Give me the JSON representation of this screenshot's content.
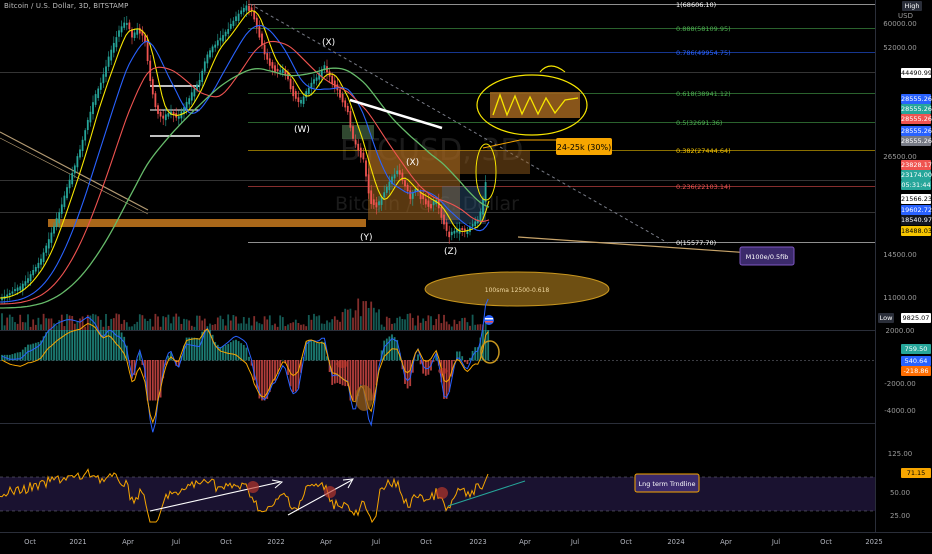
{
  "header": {
    "symbol_title": "Bitcoin / U.S. Dollar, 3D, BITSTAMP",
    "high_badge": "High",
    "usd_label": "USD",
    "low_badge": "Low"
  },
  "watermark": {
    "line1": "BTCUSD, 3D",
    "line2": "Bitcoin / U.S. Dollar"
  },
  "price_axis": {
    "ticks": [
      "60000.00",
      "52000.00",
      "44490.99",
      "26500.00",
      "21566.23",
      "18488.03",
      "14500.00",
      "11000.00",
      "9825.07"
    ],
    "tags": [
      {
        "text": "28555.26",
        "color": "#2962ff"
      },
      {
        "text": "28555.26",
        "color": "#26a69a"
      },
      {
        "text": "28555.26",
        "color": "#ef5350"
      },
      {
        "text": "28555.26",
        "color": "#2962ff"
      },
      {
        "text": "28555.26",
        "color": "#787b86"
      },
      {
        "text": "23828.17",
        "color": "#ef5350"
      },
      {
        "text": "23174.00",
        "color": "#26a69a"
      },
      {
        "text": "05:31:44",
        "color": "#26a69a"
      },
      {
        "text": "19602.72",
        "color": "#2962ff"
      },
      {
        "text": "18540.97",
        "color": "#000000"
      },
      {
        "text": "18488.03",
        "color": "#f7c600"
      }
    ]
  },
  "macd_axis": {
    "ticks": [
      "2000.00",
      "-2000.00",
      "-4000.00"
    ],
    "tags": [
      {
        "text": "759.50",
        "color": "#26a69a"
      },
      {
        "text": "540.64",
        "color": "#2962ff"
      },
      {
        "text": "-218.86",
        "color": "#ff6d00"
      }
    ]
  },
  "rsi_axis": {
    "ticks": [
      "125.00",
      "50.00",
      "25.00"
    ],
    "tag": {
      "text": "71.15",
      "color": "#f7a600"
    }
  },
  "time_axis": [
    "Oct",
    "2021",
    "Apr",
    "Jul",
    "Oct",
    "2022",
    "Apr",
    "Jul",
    "Oct",
    "2023",
    "Apr",
    "Jul",
    "Oct",
    "2024",
    "Apr",
    "Jul",
    "Oct",
    "2025"
  ],
  "fib_levels": [
    {
      "label": "1(68606.10)",
      "color": "#ffffff"
    },
    {
      "label": "0.888(58109.95)",
      "color": "#4caf50"
    },
    {
      "label": "0.786(49954.75)",
      "color": "#2962ff"
    },
    {
      "label": "0.618(38941.12)",
      "color": "#4caf50"
    },
    {
      "label": "0.5(32691.36)",
      "color": "#4caf50"
    },
    {
      "label": "0.382(27444.64)",
      "color": "#f7c600"
    },
    {
      "label": "0.236(22103.14)",
      "color": "#ef5350"
    },
    {
      "label": "0(15577.70)",
      "color": "#ffffff"
    }
  ],
  "wave_labels": [
    "(X)",
    "(W)",
    "(X)",
    "(Y)",
    "(Z)"
  ],
  "annotations": {
    "target_box": "24-25k (30%)",
    "ma_note": "M100e/0.5fib",
    "sma_note": "100sma 12500-0.618",
    "rsi_note": "Lng term Trndline"
  },
  "colors": {
    "up": "#26a69a",
    "down": "#ef5350",
    "ma_yellow": "#f7e600",
    "ma_blue": "#2962ff",
    "ma_red": "#ef5350",
    "ma_green": "#66bb6a",
    "orange": "#f7a600",
    "purple": "#6b3fa0"
  }
}
